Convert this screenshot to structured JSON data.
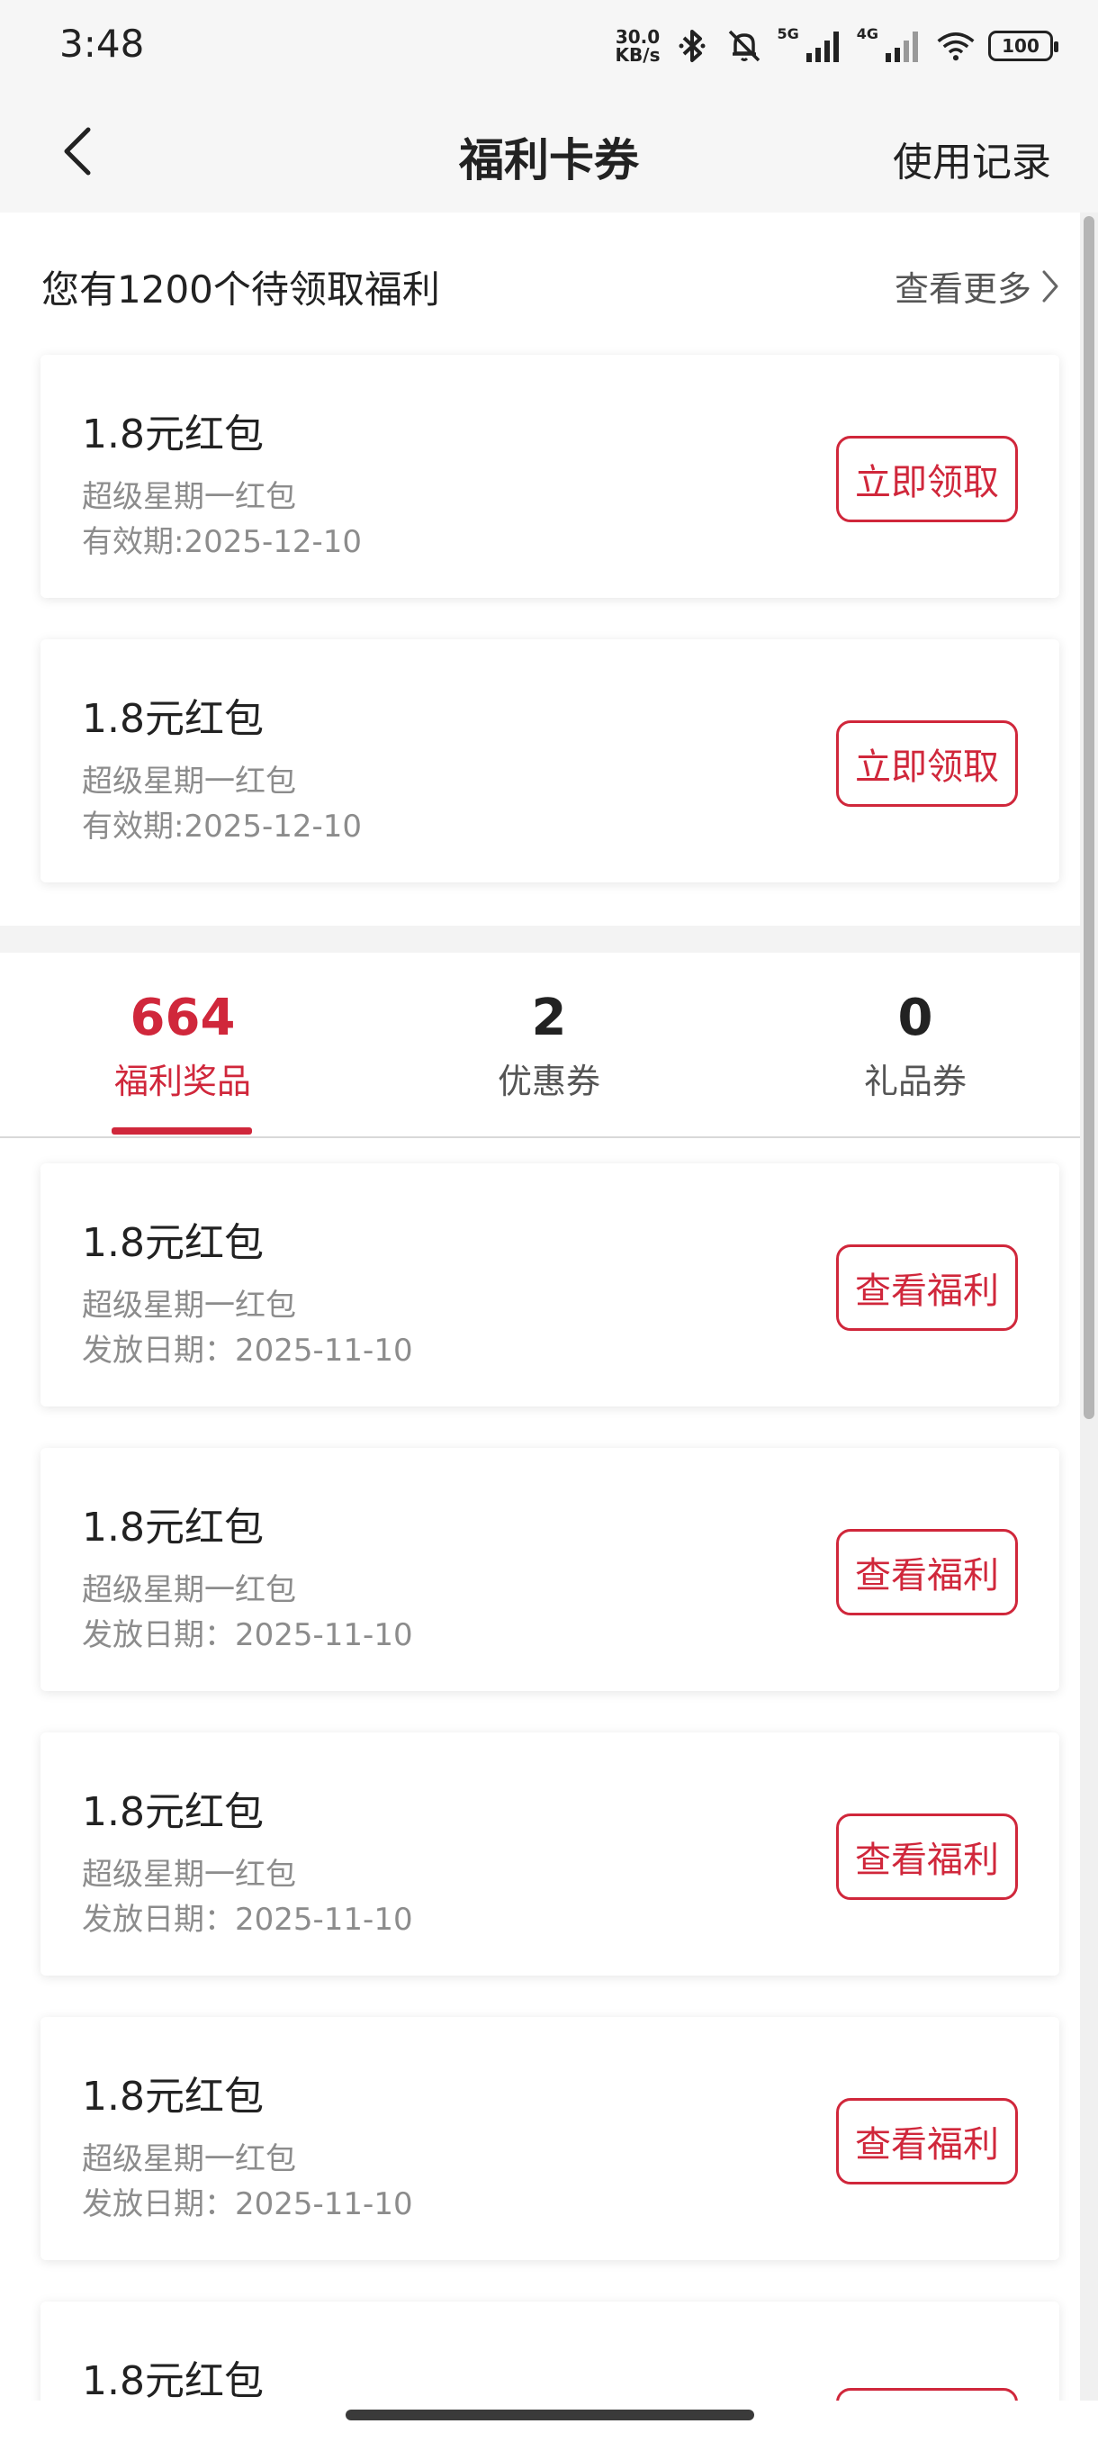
{
  "status_bar": {
    "time": "3:48",
    "speed_value": "30.0",
    "speed_unit": "KB/s",
    "net1": "5G",
    "net2": "4G",
    "battery": "100"
  },
  "nav": {
    "title": "福利卡券",
    "record_label": "使用记录"
  },
  "pending": {
    "heading": "您有1200个待领取福利",
    "more_label": "查看更多",
    "cards": [
      {
        "title": "1.8元红包",
        "subtitle": "超级星期一红包",
        "date": "有效期:2025-12-10",
        "button": "立即领取"
      },
      {
        "title": "1.8元红包",
        "subtitle": "超级星期一红包",
        "date": "有效期:2025-12-10",
        "button": "立即领取"
      }
    ]
  },
  "tabs": [
    {
      "count": "664",
      "label": "福利奖品"
    },
    {
      "count": "2",
      "label": "优惠券"
    },
    {
      "count": "0",
      "label": "礼品券"
    }
  ],
  "benefits": [
    {
      "title": "1.8元红包",
      "subtitle": "超级星期一红包",
      "date": "发放日期：2025-11-10",
      "button": "查看福利"
    },
    {
      "title": "1.8元红包",
      "subtitle": "超级星期一红包",
      "date": "发放日期：2025-11-10",
      "button": "查看福利"
    },
    {
      "title": "1.8元红包",
      "subtitle": "超级星期一红包",
      "date": "发放日期：2025-11-10",
      "button": "查看福利"
    },
    {
      "title": "1.8元红包",
      "subtitle": "超级星期一红包",
      "date": "发放日期：2025-11-10",
      "button": "查看福利"
    },
    {
      "title": "1.8元红包",
      "subtitle": "",
      "date": "",
      "button": ""
    }
  ],
  "colors": {
    "accent": "#d0273b",
    "secondary_text": "#8c8c8c"
  }
}
